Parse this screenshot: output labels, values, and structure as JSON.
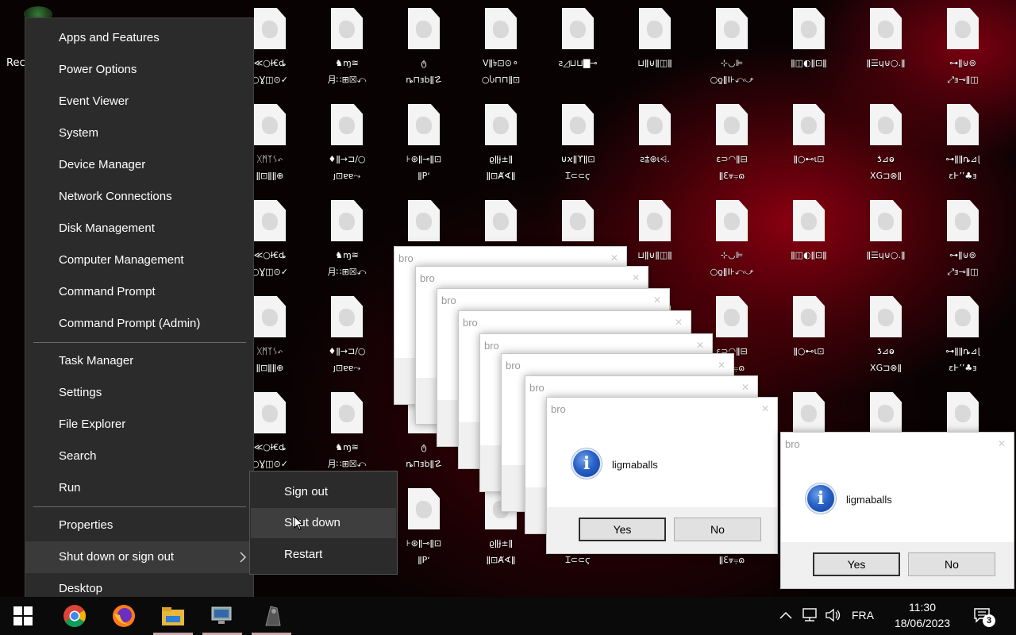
{
  "desktop": {
    "recycle_bin_label": "Rec",
    "icons": [
      {
        "line1": "≪○Ɨ€ȡ",
        "line2": "○Ɣ◫⊙✓"
      },
      {
        "line1": "♞ɱ≊",
        "line2": "月∷⊞☒⤺"
      },
      {
        "line1": "ტ",
        "line2": "ȵ⊓ⱻbǁ☡"
      },
      {
        "line1": "Vǁ৳⊡⊙⚬",
        "line2": "○Ⴑ⊓⊓ǁ⊡"
      },
      {
        "line1": "ƨ◿⊔⊔▇⊸",
        "line2": ""
      },
      {
        "line1": "⊔ǁ⊍ǁ◫ǁ",
        "line2": ""
      },
      {
        "line1": "⊹◡⊫",
        "line2": "○ƍǁ⊪⤺⤻"
      },
      {
        "line1": "ǁ◫◐ǁ⊡ǁ",
        "line2": ""
      },
      {
        "line1": "ǁ☰ɥ⊍○.ǁ",
        "line2": ""
      },
      {
        "line1": "⊶ǁ⊍⊚",
        "line2": "⤢ⱻ⊸ǁ◫"
      },
      {
        "line1": "ᚷᛗᛉᛊ⤺",
        "line2": "ǁ⊡ǁǁ⊕"
      },
      {
        "line1": "♦ǁ→⊐∕○",
        "line2": "ȷ⊡ɐɐ⤳"
      },
      {
        "line1": "⊦⊛ǁ⊸ǁ⊡",
        "line2": "ǁPʻ"
      },
      {
        "line1": "ϱǁɉ±ǁ",
        "line2": "ǁ⊡Ⱥ∢ǁ"
      },
      {
        "line1": "⊍ϰǁϒǁ⊡",
        "line2": "Ɪ⊂⊂ϛ"
      },
      {
        "line1": "ƨ⩲⊛ɩ⩤.",
        "line2": ""
      },
      {
        "line1": "ɛ⊃◠ǁ⊟",
        "line2": "ǁƐ⩔⩦ɷ"
      },
      {
        "line1": "ǁ○⊷ɩ⊡",
        "line2": ""
      },
      {
        "line1": "ƾ⊿ⱺ",
        "line2": "ⅩG⊐⊗ǁ"
      },
      {
        "line1": "⊶ǁǁȵ⊿ɭ",
        "line2": "ɛⱵʼʼ♣ⱻ"
      }
    ]
  },
  "start_menu": {
    "items": [
      "Apps and Features",
      "Power Options",
      "Event Viewer",
      "System",
      "Device Manager",
      "Network Connections",
      "Disk Management",
      "Computer Management",
      "Command Prompt",
      "Command Prompt (Admin)",
      "Task Manager",
      "Settings",
      "File Explorer",
      "Search",
      "Run",
      "Properties",
      "Shut down or sign out",
      "Desktop"
    ]
  },
  "shutdown_submenu": {
    "items": [
      "Sign out",
      "Shut down",
      "Restart"
    ],
    "highlighted": "Shut down"
  },
  "message_boxes": {
    "title": "bro",
    "message": "ligmaballs",
    "yes_label": "Yes",
    "no_label": "No",
    "close_glyph": "✕"
  },
  "taskbar": {
    "apps": [
      "start-icon",
      "chrome-icon",
      "firefox-icon",
      "file-explorer-icon",
      "network-app-icon",
      "app-icon"
    ],
    "language": "FRA",
    "time": "11:30",
    "date": "18/06/2023",
    "notification_count": "3"
  }
}
